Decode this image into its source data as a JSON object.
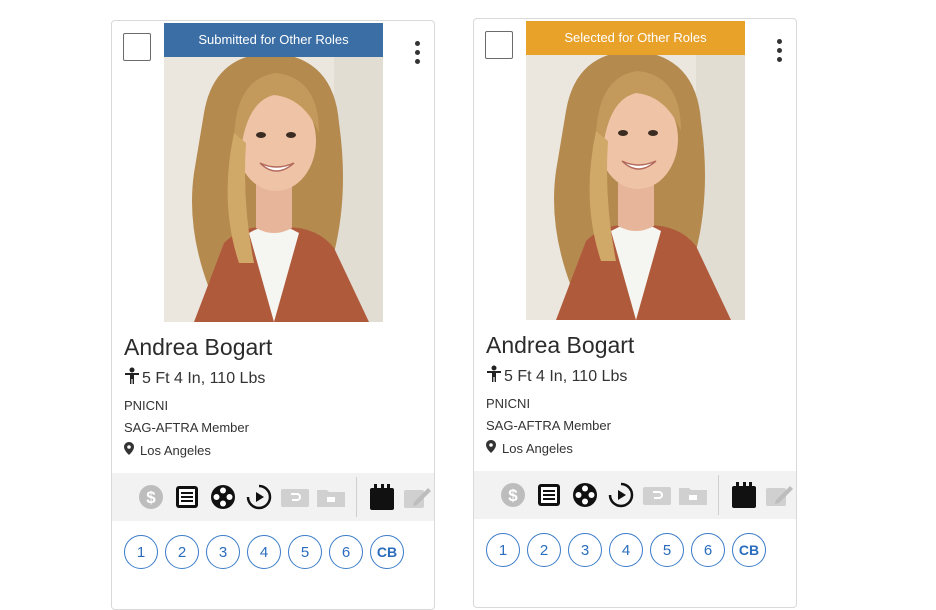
{
  "colors": {
    "submitted_badge": "#3a6ea5",
    "selected_badge": "#e8a22a",
    "role_blue": "#3a7bc8",
    "icon_dark": "#111111",
    "icon_muted": "#bfbfbf"
  },
  "cards": [
    {
      "badge": "Submitted for Other Roles",
      "name": "Andrea Bogart",
      "stats": "5 Ft 4 In, 110 Lbs",
      "agency": "PNICNI",
      "union": "SAG-AFTRA Member",
      "location": "Los Angeles",
      "roles": [
        "1",
        "2",
        "3",
        "4",
        "5",
        "6",
        "CB"
      ]
    },
    {
      "badge": "Selected for Other Roles",
      "name": "Andrea Bogart",
      "stats": "5 Ft 4 In, 110 Lbs",
      "agency": "PNICNI",
      "union": "SAG-AFTRA Member",
      "location": "Los Angeles",
      "roles": [
        "1",
        "2",
        "3",
        "4",
        "5",
        "6",
        "CB"
      ]
    }
  ],
  "icons": {
    "checkbox": "checkbox-icon",
    "more": "more-vertical-icon",
    "person": "person-icon",
    "location": "location-pin-icon",
    "dollar": "dollar-icon",
    "resume": "resume-icon",
    "reel": "film-reel-icon",
    "play": "play-icon",
    "attachment": "attachment-icon",
    "folder": "folder-icon",
    "calendar": "calendar-icon",
    "edit": "edit-icon"
  }
}
